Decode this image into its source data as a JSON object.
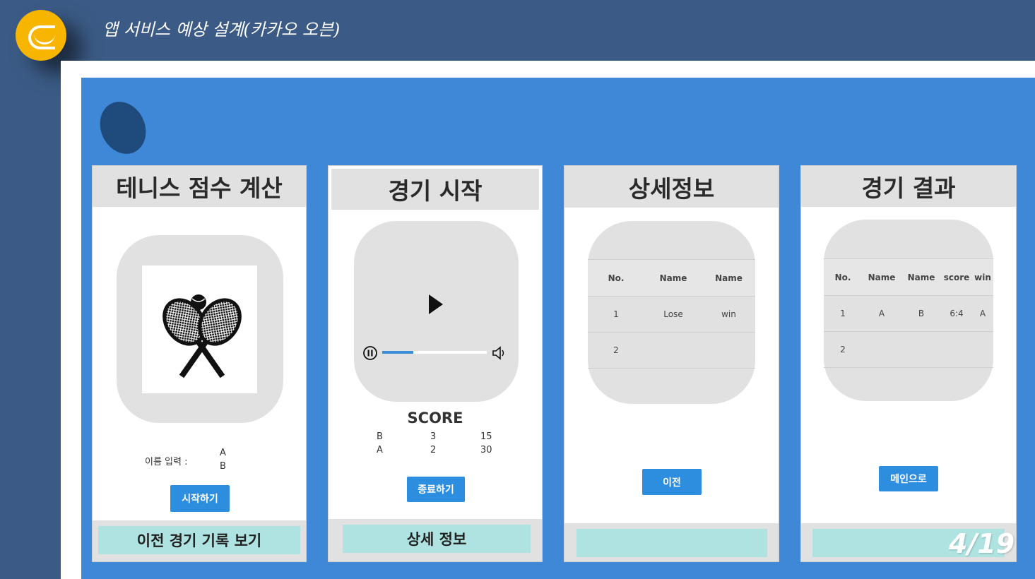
{
  "header": {
    "title": "앱 서비스 예상 설계(카카오 오븐)"
  },
  "page_number": "4/19",
  "screen1": {
    "title": "테니스 점수 계산",
    "name_label": "이름 입력 :",
    "names": [
      "A",
      "B"
    ],
    "start_button": "시작하기",
    "footer": "이전 경기 기록 보기"
  },
  "screen2": {
    "title": "경기 시작",
    "progress": 0.3,
    "score_title": "SCORE",
    "rows": [
      {
        "player": "B",
        "games": "3",
        "points": "15"
      },
      {
        "player": "A",
        "games": "2",
        "points": "30"
      }
    ],
    "end_button": "종료하기",
    "footer": "상세 정보"
  },
  "screen3": {
    "title": "상세정보",
    "headers": [
      "No.",
      "Name",
      "Name"
    ],
    "rows": [
      [
        "1",
        "Lose",
        "win"
      ],
      [
        "2",
        "",
        ""
      ]
    ],
    "prev_button": "이전"
  },
  "screen4": {
    "title": "경기 결과",
    "headers": [
      "No.",
      "Name",
      "Name",
      "score",
      "win"
    ],
    "rows": [
      [
        "1",
        "A",
        "B",
        "6:4",
        "A"
      ],
      [
        "2",
        "",
        "",
        "",
        ""
      ]
    ],
    "main_button": "메인으로"
  }
}
